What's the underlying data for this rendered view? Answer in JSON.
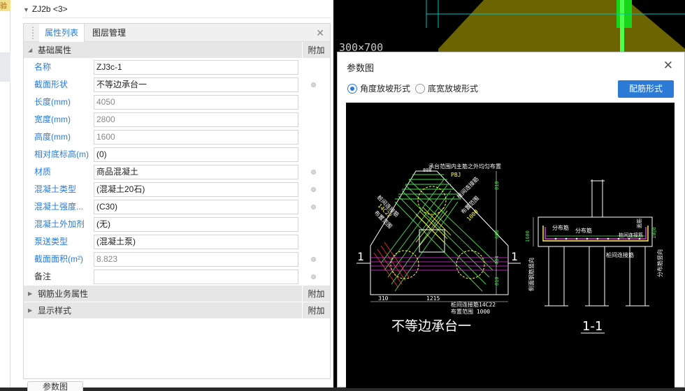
{
  "left_strip": {
    "tag": "验"
  },
  "panel": {
    "header": "ZJ2b <3>",
    "tabs": [
      "属性列表",
      "图层管理"
    ],
    "groups": {
      "basic": "基础属性",
      "rebar": "钢筋业务属性",
      "display": "显示样式",
      "extra": "附加"
    },
    "rows": [
      {
        "name": "名称",
        "value": "ZJ3c-1"
      },
      {
        "name": "截面形状",
        "value": "不等边承台一"
      },
      {
        "name": "长度(mm)",
        "value": "4050"
      },
      {
        "name": "宽度(mm)",
        "value": "2800"
      },
      {
        "name": "高度(mm)",
        "value": "1600"
      },
      {
        "name": "相对底标高(m)",
        "value": "(0)"
      },
      {
        "name": "材质",
        "value": "商品混凝土"
      },
      {
        "name": "混凝土类型",
        "value": "(混凝土20石)"
      },
      {
        "name": "混凝土强度...",
        "value": "(C30)"
      },
      {
        "name": "混凝土外加剂",
        "value": "(无)"
      },
      {
        "name": "泵送类型",
        "value": "(混凝土泵)"
      },
      {
        "name": "截面面积(m²)",
        "value": "8.823"
      },
      {
        "name": "备注",
        "value": ""
      }
    ],
    "bottom_btn": "参数图"
  },
  "cad_bg": {
    "dim_text": "300×700"
  },
  "dialog": {
    "title": "参数图",
    "radio1": "角度放坡形式",
    "radio2": "底宽放坡形式",
    "button": "配筋形式",
    "drawing": {
      "title_left": "不等边承台一",
      "title_right": "1-1",
      "note_top": "承台范围内主筋之外均匀布置",
      "note_pbj": "PBJ",
      "dim_808": "808",
      "dim_810a": "810",
      "dim_696": "686",
      "dim_404": "404",
      "dim_810b": "810",
      "dim_310": "310",
      "dim_1215": "1215",
      "lbl_pile1": "桩间连接筋",
      "lbl_pile2": "14C22",
      "lbl_range": "布置范围",
      "lbl_range2": "1000",
      "bottom_note1": "桩间连接筋14C22",
      "bottom_note2": "布置范围 1000",
      "sec_fbj1": "分布筋",
      "sec_fbj2": "分布筋",
      "sec_zj": "桩间连接筋",
      "sec_mzj": "面筋",
      "sec_side": "侧面钢筋竖向",
      "sec_1600": "1600",
      "sec_right": "分布筋竖向",
      "sec_sp": "10@d",
      "sec_zj2": "桩间连接筋",
      "mark1": "1",
      "mark2": "1"
    }
  }
}
